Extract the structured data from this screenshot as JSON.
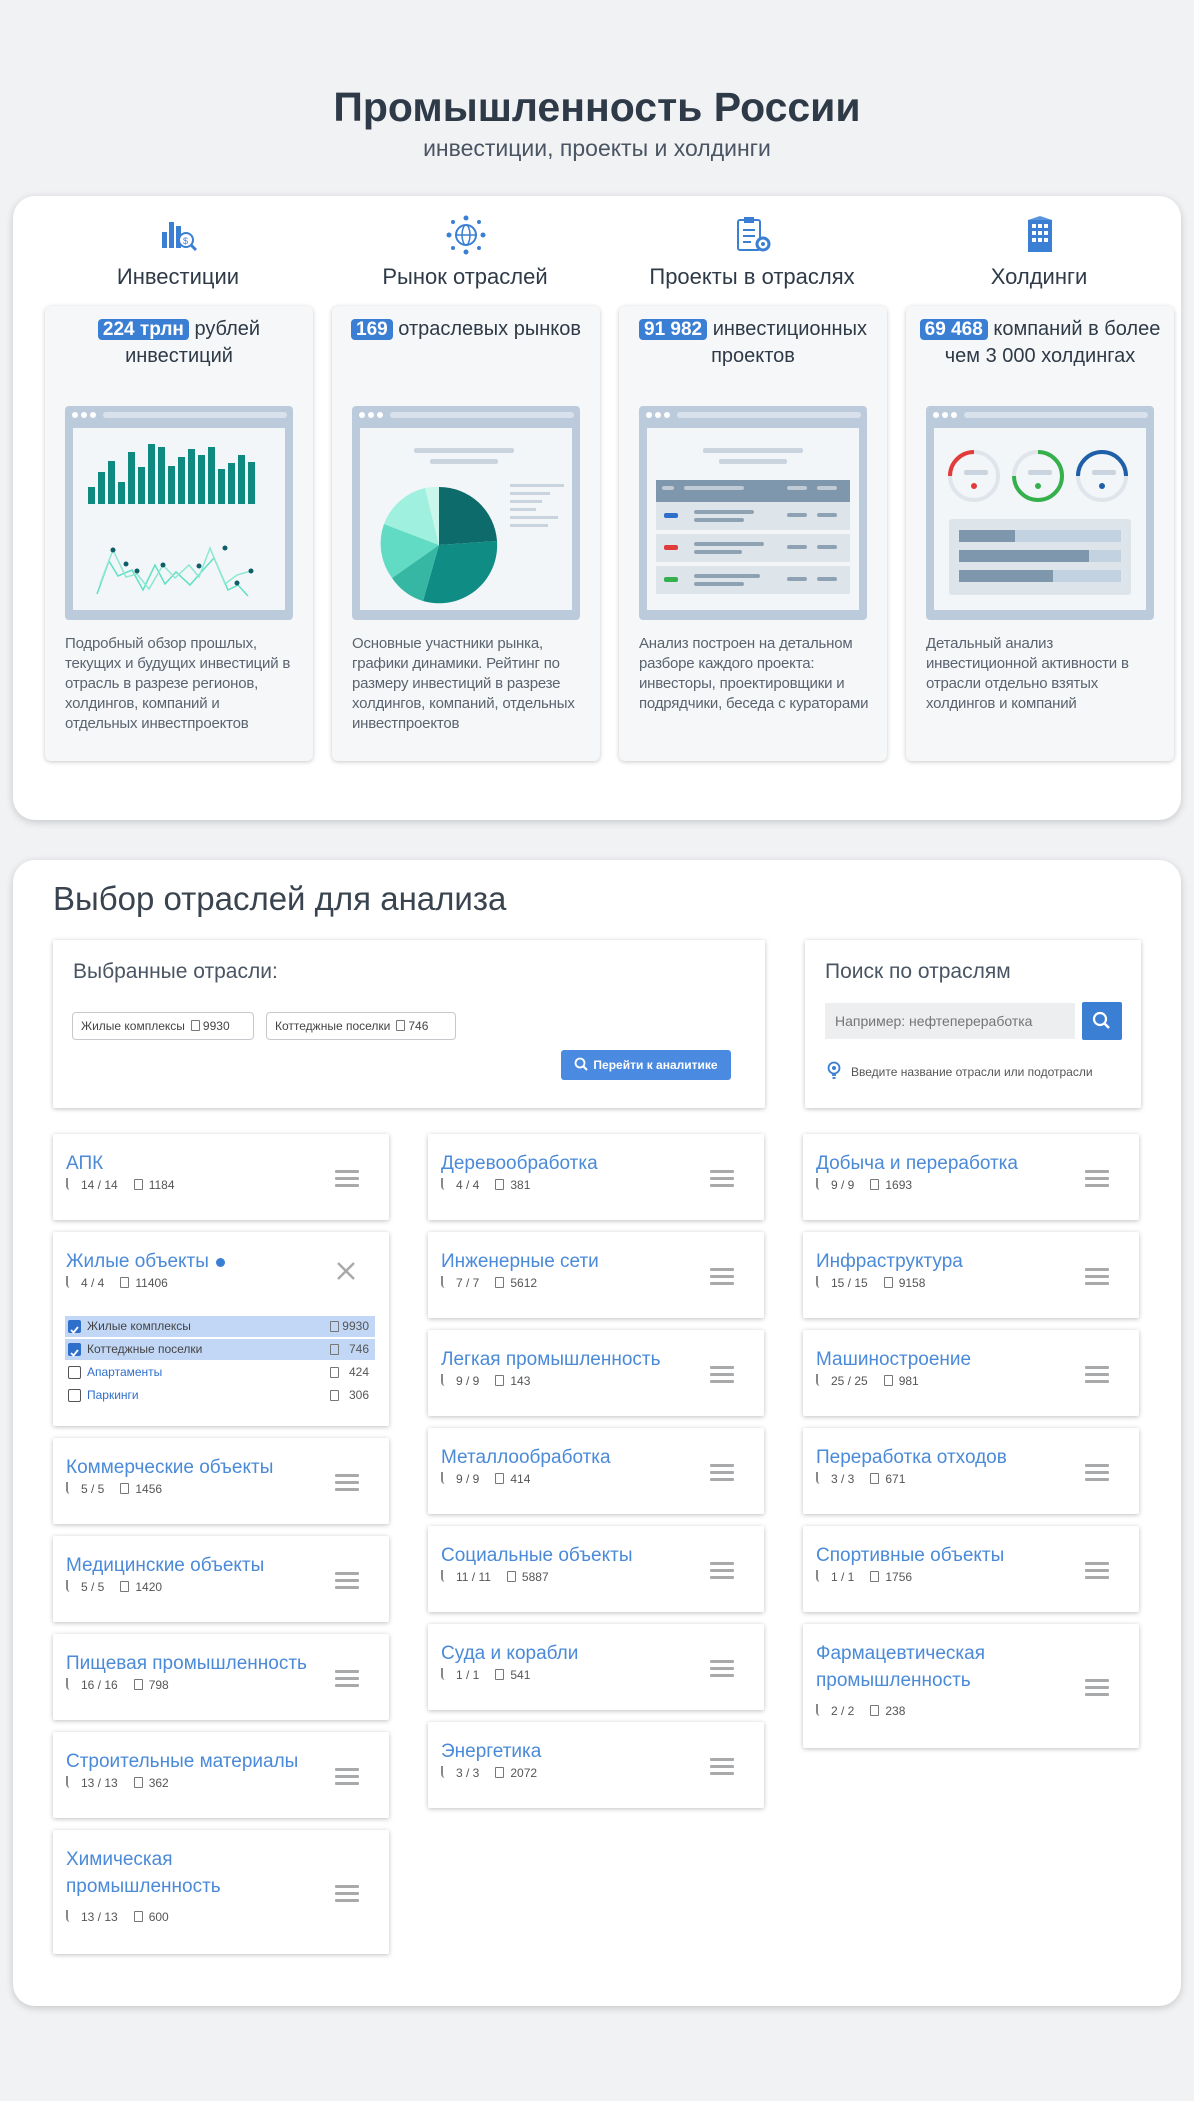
{
  "hero": {
    "title": "Промышленность России",
    "subtitle": "инвестиции, проекты и холдинги"
  },
  "features": [
    {
      "title": "Инвестиции",
      "icon": "investments-chart-icon",
      "badge": "224 трлн",
      "headline": "рублей инвестиций",
      "description": "Подробный обзор прошлых, текущих и будущих инвестиций в отрасль в разрезе регионов, холдингов, компаний и отдельных инвестпроектов"
    },
    {
      "title": "Рынок отраслей",
      "icon": "globe-network-icon",
      "badge": "169",
      "headline": "отраслевых рынков",
      "description": "Основные участники рынка, графики динамики. Рейтинг по размеру инвестиций в разрезе холдингов, компаний, отдельных инвестпроектов"
    },
    {
      "title": "Проекты в отраслях",
      "icon": "clipboard-gear-icon",
      "badge": "91 982",
      "headline": "инвестиционных проектов",
      "description": "Анализ построен на детальном разборе каждого проекта: инвесторы, проектировщики и подрядчики, беседа с кураторами"
    },
    {
      "title": "Холдинги",
      "icon": "building-icon",
      "badge": "69 468",
      "headline": "компаний в более чем 3 000 холдингах",
      "description": "Детальный анализ инвестиционной активности в отрасли отдельно взятых холдингов и компаний"
    }
  ],
  "selection": {
    "section_title": "Выбор отраслей для анализа",
    "selected_title": "Выбранные отрасли:",
    "chips": [
      {
        "label": "Жилые комплексы",
        "count": "9930"
      },
      {
        "label": "Коттеджные поселки",
        "count": "746"
      }
    ],
    "go_button": "Перейти к аналитике",
    "search_title": "Поиск по отраслям",
    "search_placeholder": "Например: нефтепереработка",
    "search_hint": "Введите название отрасли или подотрасли"
  },
  "industries": {
    "col1": [
      {
        "name": "АПК",
        "sub": "14 / 14",
        "docs": "1184"
      },
      {
        "name": "Жилые объекты",
        "sub": "4 / 4",
        "docs": "11406",
        "expanded": true,
        "subitems": [
          {
            "label": "Жилые комплексы",
            "count": "9930",
            "checked": true
          },
          {
            "label": "Коттеджные поселки",
            "count": "746",
            "checked": true
          },
          {
            "label": "Апартаменты",
            "count": "424",
            "checked": false
          },
          {
            "label": "Паркинги",
            "count": "306",
            "checked": false
          }
        ]
      },
      {
        "name": "Коммерческие объекты",
        "sub": "5 / 5",
        "docs": "1456"
      },
      {
        "name": "Медицинские объекты",
        "sub": "5 / 5",
        "docs": "1420"
      },
      {
        "name": "Пищевая промышленность",
        "sub": "16 / 16",
        "docs": "798"
      },
      {
        "name": "Строительные материалы",
        "sub": "13 / 13",
        "docs": "362"
      },
      {
        "name": "Химическая промышленность",
        "sub": "13 / 13",
        "docs": "600"
      }
    ],
    "col2": [
      {
        "name": "Деревообработка",
        "sub": "4 / 4",
        "docs": "381"
      },
      {
        "name": "Инженерные сети",
        "sub": "7 / 7",
        "docs": "5612"
      },
      {
        "name": "Легкая промышленность",
        "sub": "9 / 9",
        "docs": "143"
      },
      {
        "name": "Металлообработка",
        "sub": "9 / 9",
        "docs": "414"
      },
      {
        "name": "Социальные объекты",
        "sub": "11 / 11",
        "docs": "5887"
      },
      {
        "name": "Суда и корабли",
        "sub": "1 / 1",
        "docs": "541"
      },
      {
        "name": "Энергетика",
        "sub": "3 / 3",
        "docs": "2072"
      }
    ],
    "col3": [
      {
        "name": "Добыча и переработка",
        "sub": "9 / 9",
        "docs": "1693"
      },
      {
        "name": "Инфраструктура",
        "sub": "15 / 15",
        "docs": "9158"
      },
      {
        "name": "Машиностроение",
        "sub": "25 / 25",
        "docs": "981"
      },
      {
        "name": "Переработка отходов",
        "sub": "3 / 3",
        "docs": "671"
      },
      {
        "name": "Спортивные объекты",
        "sub": "1 / 1",
        "docs": "1756"
      },
      {
        "name": "Фармацевтическая промышленность",
        "sub": "2 / 2",
        "docs": "238"
      }
    ]
  },
  "colors": {
    "accent": "#3b7fd4",
    "link": "#4a8ad8",
    "teal": "#0e8a80"
  }
}
